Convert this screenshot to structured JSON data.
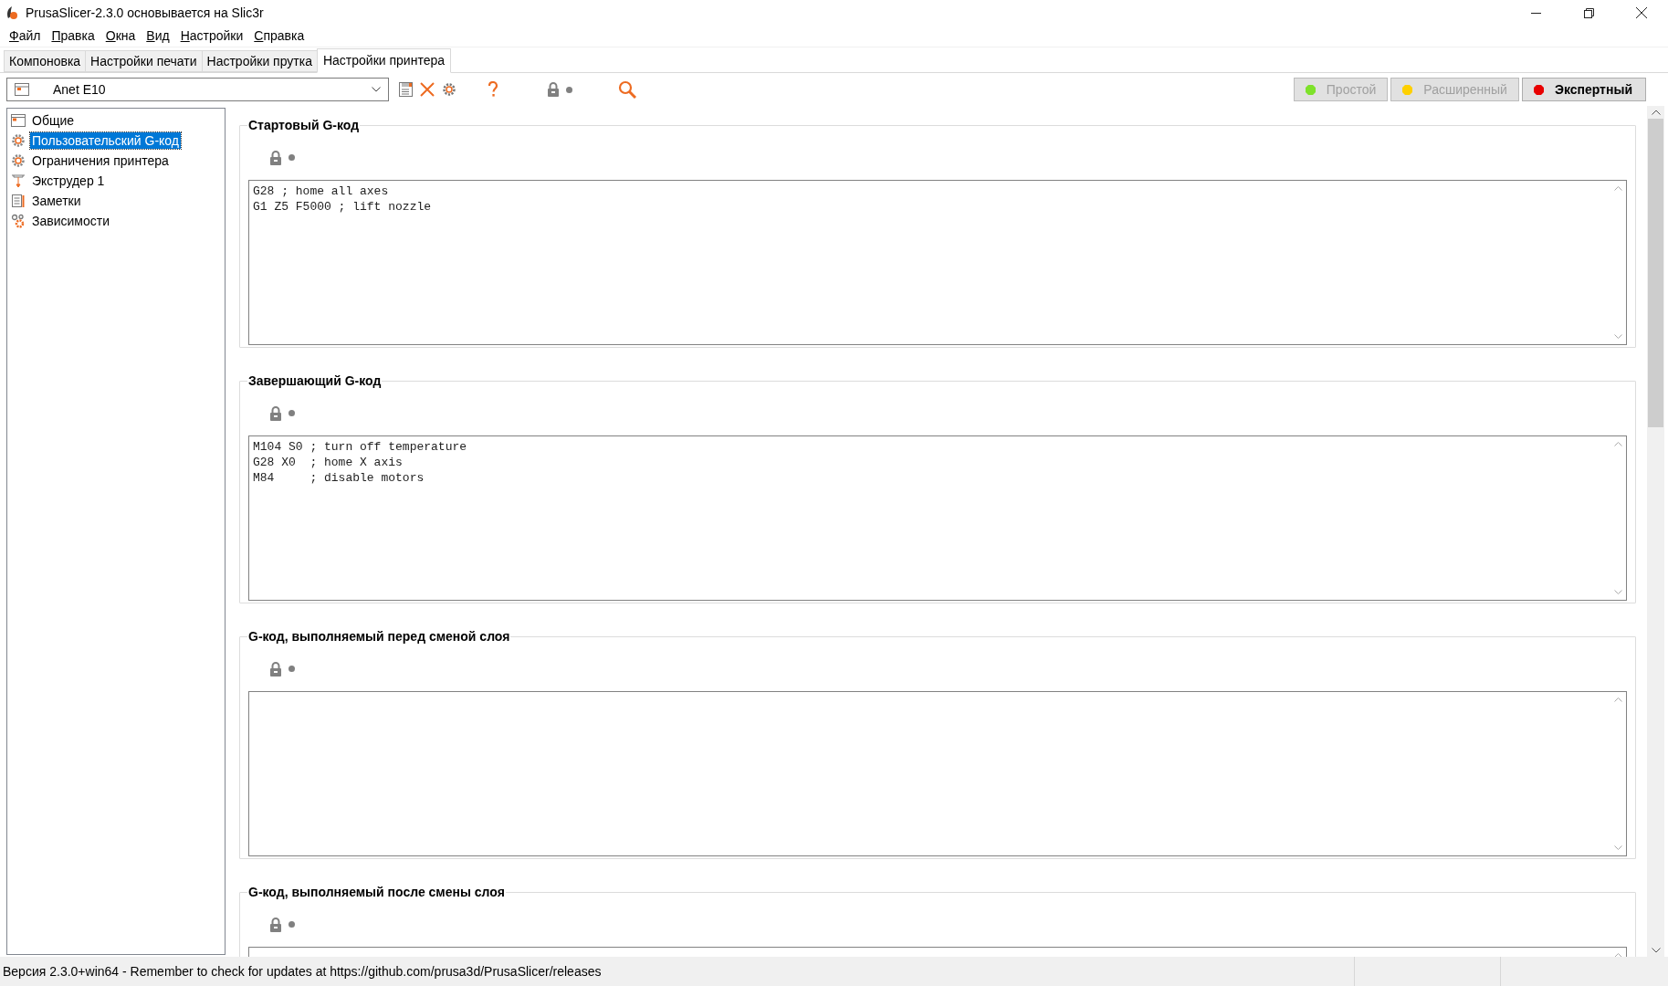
{
  "window": {
    "title": "PrusaSlicer-2.3.0 основывается на Slic3r"
  },
  "menu": [
    "Файл",
    "Правка",
    "Окна",
    "Вид",
    "Настройки",
    "Справка"
  ],
  "tabs": [
    {
      "label": "Компоновка",
      "selected": false
    },
    {
      "label": "Настройки печати",
      "selected": false
    },
    {
      "label": "Настройки прутка",
      "selected": false
    },
    {
      "label": "Настройки принтера",
      "selected": true
    }
  ],
  "preset": {
    "value": "Anet E10"
  },
  "modes": [
    {
      "label": "Простой",
      "color": "#7ee22b",
      "selected": false
    },
    {
      "label": "Расширенный",
      "color": "#fed000",
      "selected": false
    },
    {
      "label": "Экспертный",
      "color": "#e80000",
      "selected": true
    }
  ],
  "sidebar": {
    "items": [
      {
        "label": "Общие",
        "kind": "page",
        "selected": false
      },
      {
        "label": "Пользовательский G-код",
        "kind": "gear",
        "selected": true
      },
      {
        "label": "Ограничения принтера",
        "kind": "gear",
        "selected": false
      },
      {
        "label": "Экструдер 1",
        "kind": "extruder",
        "selected": false
      },
      {
        "label": "Заметки",
        "kind": "notes",
        "selected": false
      },
      {
        "label": "Зависимости",
        "kind": "deps",
        "selected": false
      }
    ]
  },
  "sections": [
    {
      "title": "Стартовый G-код",
      "code": "G28 ; home all axes\nG1 Z5 F5000 ; lift nozzle"
    },
    {
      "title": "Завершающий G-код",
      "code": "M104 S0 ; turn off temperature\nG28 X0  ; home X axis\nM84     ; disable motors"
    },
    {
      "title": "G-код, выполняемый перед сменой слоя"
    },
    {
      "title": "G-код, выполняемый после смены слоя"
    }
  ],
  "status_bar": {
    "text": "Версия 2.3.0+win64 - Remember to check for updates at https://github.com/prusa3d/PrusaSlicer/releases"
  }
}
